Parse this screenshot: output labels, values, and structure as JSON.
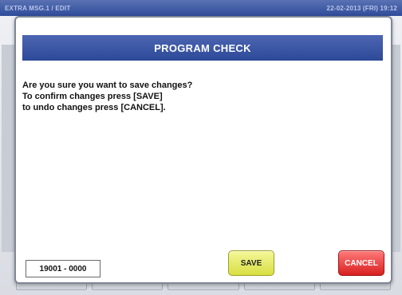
{
  "topbar": {
    "left_text": "EXTRA MSG.1 / EDIT",
    "right_text": "22-02-2013 (FRI) 19:12"
  },
  "dialog": {
    "title": "PROGRAM CHECK",
    "message_lines": [
      "Are you sure you want to save changes?",
      "To confirm changes press [SAVE]",
      "to undo changes press [CANCEL]."
    ],
    "code": "19001 - 0000",
    "save_label": "SAVE",
    "cancel_label": "CANCEL"
  },
  "colors": {
    "header_blue": "#2d4997",
    "save_yellow": "#d8df42",
    "cancel_red": "#d81f1f"
  }
}
